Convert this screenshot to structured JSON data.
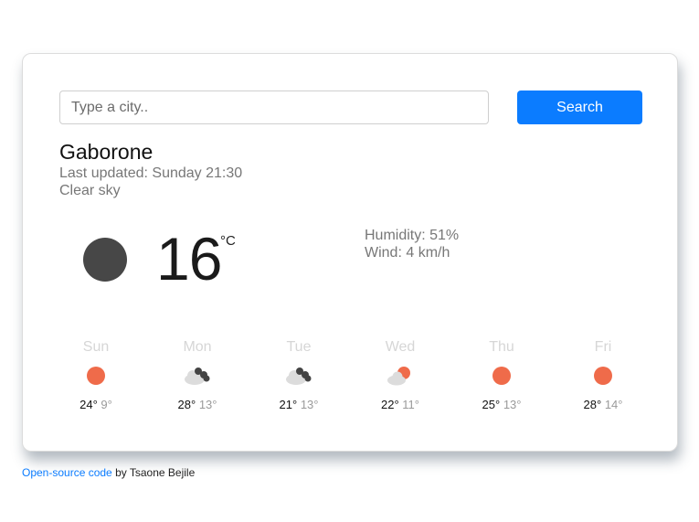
{
  "search": {
    "placeholder": "Type a city..",
    "button_label": "Search"
  },
  "current": {
    "city": "Gaborone",
    "last_updated": "Last updated: Sunday 21:30",
    "description": "Clear sky",
    "temperature": "16",
    "unit": "°C",
    "icon": "clear-night-moon-icon",
    "humidity": "Humidity: 51%",
    "wind": "Wind: 4 km/h"
  },
  "forecast": [
    {
      "day": "Sun",
      "high": "24°",
      "low": "9°",
      "icon": "sun-icon"
    },
    {
      "day": "Mon",
      "high": "28°",
      "low": "13°",
      "icon": "broken-clouds-icon"
    },
    {
      "day": "Tue",
      "high": "21°",
      "low": "13°",
      "icon": "broken-clouds-icon"
    },
    {
      "day": "Wed",
      "high": "22°",
      "low": "11°",
      "icon": "partly-cloudy-icon"
    },
    {
      "day": "Thu",
      "high": "25°",
      "low": "13°",
      "icon": "sun-icon"
    },
    {
      "day": "Fri",
      "high": "28°",
      "low": "14°",
      "icon": "sun-icon"
    }
  ],
  "footer": {
    "link_text": "Open-source code",
    "suffix": " by Tsaone Bejile"
  },
  "colors": {
    "accent": "#0b7cff",
    "sun": "#ef6b4a",
    "cloud": "#dcdcdc",
    "cloud_dark": "#444444",
    "moon": "#474747"
  }
}
